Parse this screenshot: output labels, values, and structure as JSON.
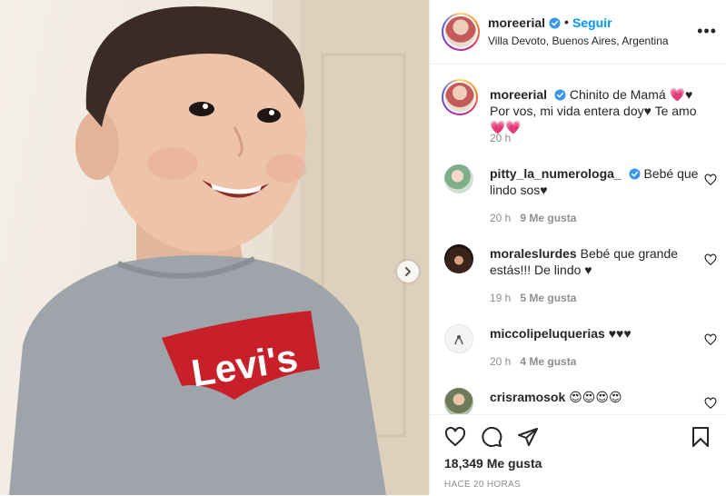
{
  "post_image": {
    "shirt_logo_text": "Levi's",
    "colors": {
      "shirt": "#9aa0a5",
      "logo_red": "#c8202a",
      "wall": "#efe7dc"
    }
  },
  "header": {
    "username": "moreerial",
    "separator": "•",
    "follow_label": "Seguir",
    "location": "Villa Devoto, Buenos Aires, Argentina",
    "more_label": "•••"
  },
  "caption": {
    "username": "moreerial",
    "text": "Chinito de Mamá 💗♥ Por vos, mi vida entera doy♥ Te amo💗💗",
    "time": "20 h"
  },
  "comments": [
    {
      "username": "pitty_la_numerologa_",
      "verified": true,
      "text": "Bebé que lindo sos♥",
      "time": "20 h",
      "likes": "9 Me gusta"
    },
    {
      "username": "moraleslurdes",
      "verified": false,
      "text": "Bebé que grande estás!!! De lindo ♥",
      "time": "19 h",
      "likes": "5 Me gusta"
    },
    {
      "username": "miccolipeluquerias",
      "verified": false,
      "text": "♥♥♥",
      "time": "20 h",
      "likes": "4 Me gusta"
    },
    {
      "username": "crisramosok",
      "verified": false,
      "text": "😍😍😍😍",
      "time": "",
      "likes": ""
    }
  ],
  "actions": {
    "like_count": "18,349 Me gusta",
    "posted_ago": "HACE 20 HORAS"
  },
  "icons": [
    "verified-badge-icon",
    "more-options-icon",
    "heart-icon",
    "comment-icon",
    "share-icon",
    "bookmark-icon",
    "chevron-right-icon"
  ],
  "colors": {
    "link_blue": "#0095f6",
    "text": "#262626",
    "muted": "#8e8e8e",
    "verified": "#3897f0"
  }
}
